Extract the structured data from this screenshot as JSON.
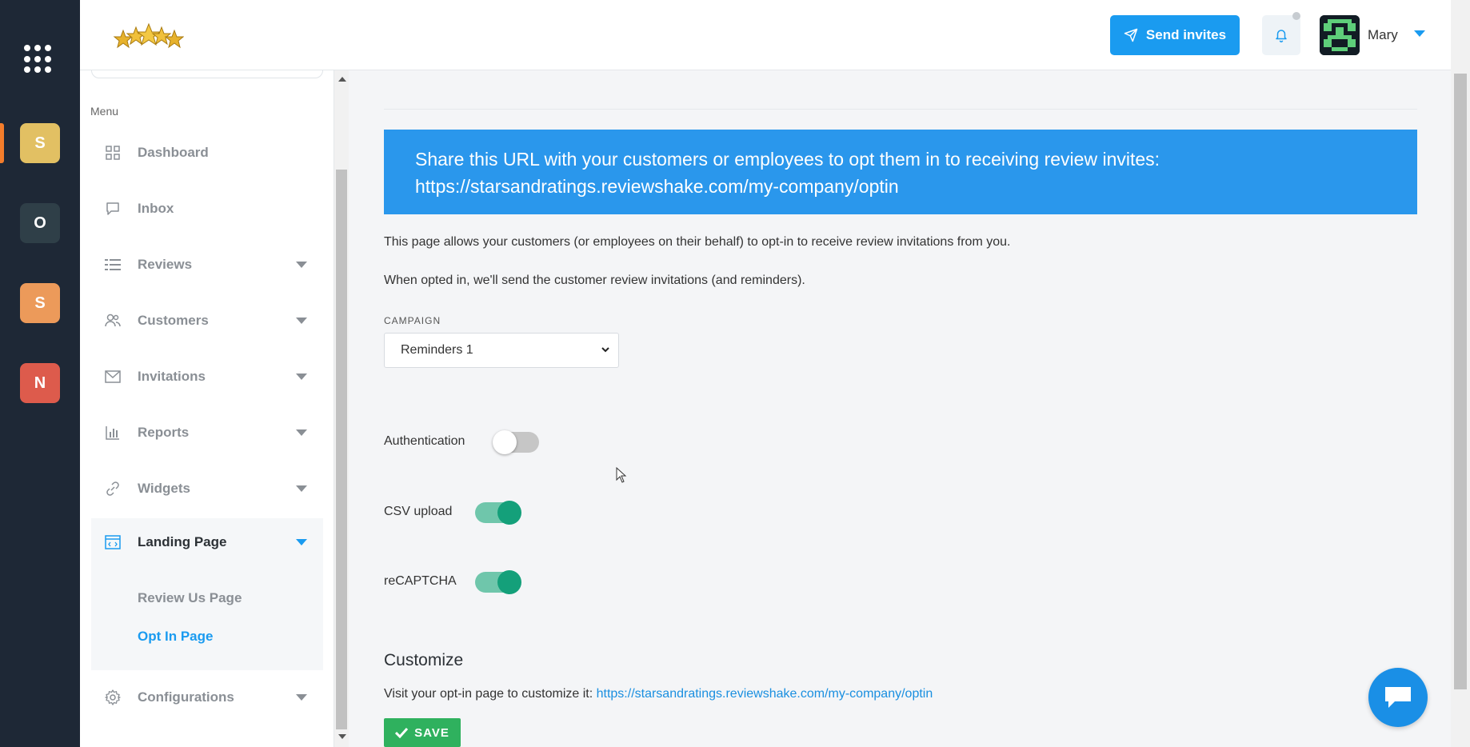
{
  "rail": {
    "apps": [
      {
        "letter": "S",
        "color": "#e2c063"
      },
      {
        "letter": "O",
        "color": "#2f3f48"
      },
      {
        "letter": "S",
        "color": "#ec9a5a"
      },
      {
        "letter": "N",
        "color": "#dd5b4c"
      }
    ]
  },
  "header": {
    "send_invites_label": "Send invites",
    "user_name": "Mary"
  },
  "sidebar": {
    "menu_label": "Menu",
    "items": [
      {
        "label": "Dashboard",
        "icon": "dashboard-grid-icon"
      },
      {
        "label": "Inbox",
        "icon": "inbox-chat-icon"
      },
      {
        "label": "Reviews",
        "icon": "reviews-list-icon"
      },
      {
        "label": "Customers",
        "icon": "customers-users-icon"
      },
      {
        "label": "Invitations",
        "icon": "envelope-icon"
      },
      {
        "label": "Reports",
        "icon": "bar-chart-icon"
      },
      {
        "label": "Widgets",
        "icon": "link-icon"
      },
      {
        "label": "Landing Page",
        "icon": "code-window-icon"
      },
      {
        "label": "Configurations",
        "icon": "gear-icon"
      }
    ],
    "sub_items": [
      {
        "label": "Review Us Page"
      },
      {
        "label": "Opt In Page"
      }
    ]
  },
  "main": {
    "banner_line1": "Share this URL with your customers or employees to opt them in to receiving review invites:",
    "banner_line2": "https://starsandratings.reviewshake.com/my-company/optin",
    "para1": "This page allows your customers (or employees on their behalf) to opt-in to receive review invitations from you.",
    "para2": "When opted in, we'll send the customer review invitations (and reminders).",
    "campaign_label": "CAMPAIGN",
    "campaign_value": "Reminders 1",
    "toggles": [
      {
        "label": "Authentication",
        "on": false
      },
      {
        "label": "CSV upload",
        "on": true
      },
      {
        "label": "reCAPTCHA",
        "on": true
      }
    ],
    "customize_heading": "Customize",
    "customize_text": "Visit your opt-in page to customize it: ",
    "customize_link": "https://starsandratings.reviewshake.com/my-company/optin",
    "save_label": "SAVE"
  },
  "colors": {
    "primary": "#1a9bf0",
    "banner": "#2a97ec",
    "toggle_on": "#14a07a",
    "save": "#2fb15e",
    "rail": "#1e2836"
  }
}
